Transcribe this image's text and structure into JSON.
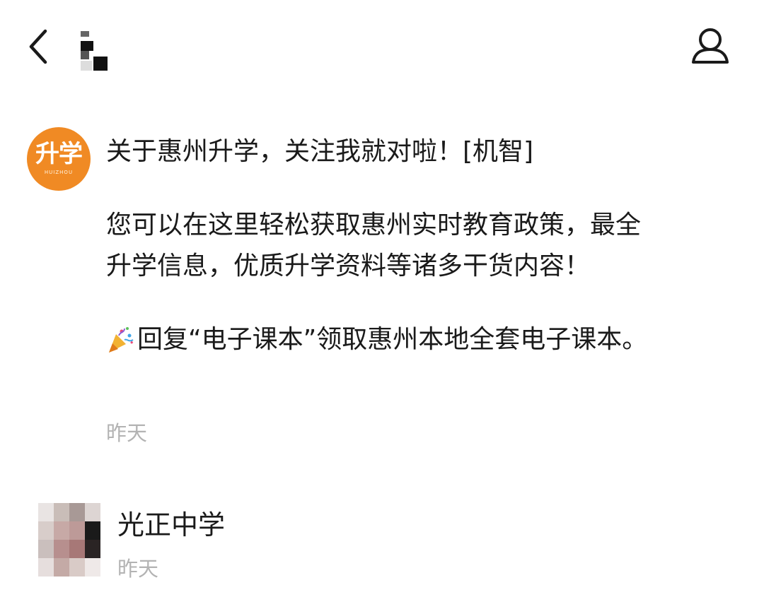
{
  "header": {
    "back_icon": "chevron-left-icon",
    "profile_icon": "person-icon"
  },
  "message": {
    "avatar": {
      "logo_text": "升学",
      "logo_sub": "HUIZHOU",
      "color": "#f08a24"
    },
    "line1": "关于惠州升学，关注我就对啦！[机智]",
    "para2": {
      "line1": "您可以在这里轻松获取惠州实时教育政策，最全",
      "line2": "升学信息，优质升学资料等诸多干货内容！"
    },
    "para3": {
      "icon": "party-popper-icon",
      "text": "回复“电子课本”领取惠州本地全套电子课本。"
    },
    "time": "昨天"
  },
  "item2": {
    "name": "光正中学",
    "time": "昨天"
  }
}
